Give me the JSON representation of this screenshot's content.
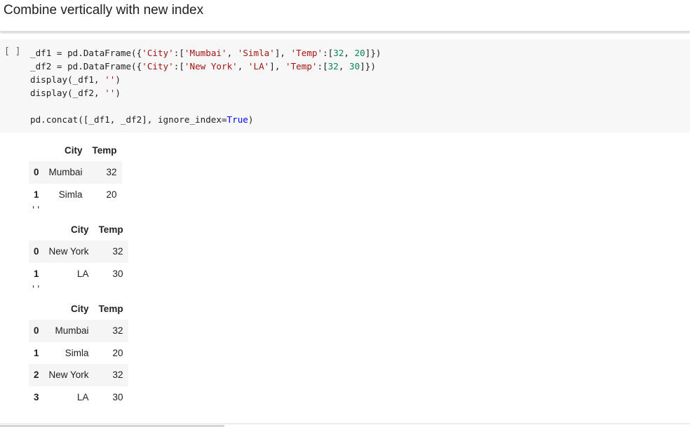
{
  "heading": "Combine vertically with new index",
  "run_indicator": "[ ]",
  "code_lines": [
    [
      [
        "",
        "_df1 = pd.DataFrame({"
      ],
      [
        "s",
        "'City'"
      ],
      [
        "",
        ":["
      ],
      [
        "s",
        "'Mumbai'"
      ],
      [
        "",
        ", "
      ],
      [
        "s",
        "'Simla'"
      ],
      [
        "",
        "], "
      ],
      [
        "s",
        "'Temp'"
      ],
      [
        "",
        ":["
      ],
      [
        "n",
        "32"
      ],
      [
        "",
        ", "
      ],
      [
        "n",
        "20"
      ],
      [
        "",
        "]})"
      ]
    ],
    [
      [
        "",
        "_df2 = pd.DataFrame({"
      ],
      [
        "s",
        "'City'"
      ],
      [
        "",
        ":["
      ],
      [
        "s",
        "'New York'"
      ],
      [
        "",
        ", "
      ],
      [
        "s",
        "'LA'"
      ],
      [
        "",
        "], "
      ],
      [
        "s",
        "'Temp'"
      ],
      [
        "",
        ":["
      ],
      [
        "n",
        "32"
      ],
      [
        "",
        ", "
      ],
      [
        "n",
        "30"
      ],
      [
        "",
        "]})"
      ]
    ],
    [
      [
        "",
        "display(_df1, "
      ],
      [
        "s",
        "''"
      ],
      [
        "",
        ")"
      ]
    ],
    [
      [
        "",
        "display(_df2, "
      ],
      [
        "s",
        "''"
      ],
      [
        "",
        ")"
      ]
    ],
    [
      [
        "",
        ""
      ]
    ],
    [
      [
        "",
        "pd.concat([_df1, _df2], ignore_index="
      ],
      [
        "k",
        "True"
      ],
      [
        "",
        ")"
      ]
    ]
  ],
  "outputs": {
    "table1": {
      "columns": [
        "",
        "City",
        "Temp"
      ],
      "rows": [
        [
          "0",
          "Mumbai",
          "32"
        ],
        [
          "1",
          "Simla",
          "20"
        ]
      ]
    },
    "sep1": "''",
    "table2": {
      "columns": [
        "",
        "City",
        "Temp"
      ],
      "rows": [
        [
          "0",
          "New York",
          "32"
        ],
        [
          "1",
          "LA",
          "30"
        ]
      ]
    },
    "sep2": "''",
    "table3": {
      "columns": [
        "",
        "City",
        "Temp"
      ],
      "rows": [
        [
          "0",
          "Mumbai",
          "32"
        ],
        [
          "1",
          "Simla",
          "20"
        ],
        [
          "2",
          "New York",
          "32"
        ],
        [
          "3",
          "LA",
          "30"
        ]
      ]
    }
  }
}
